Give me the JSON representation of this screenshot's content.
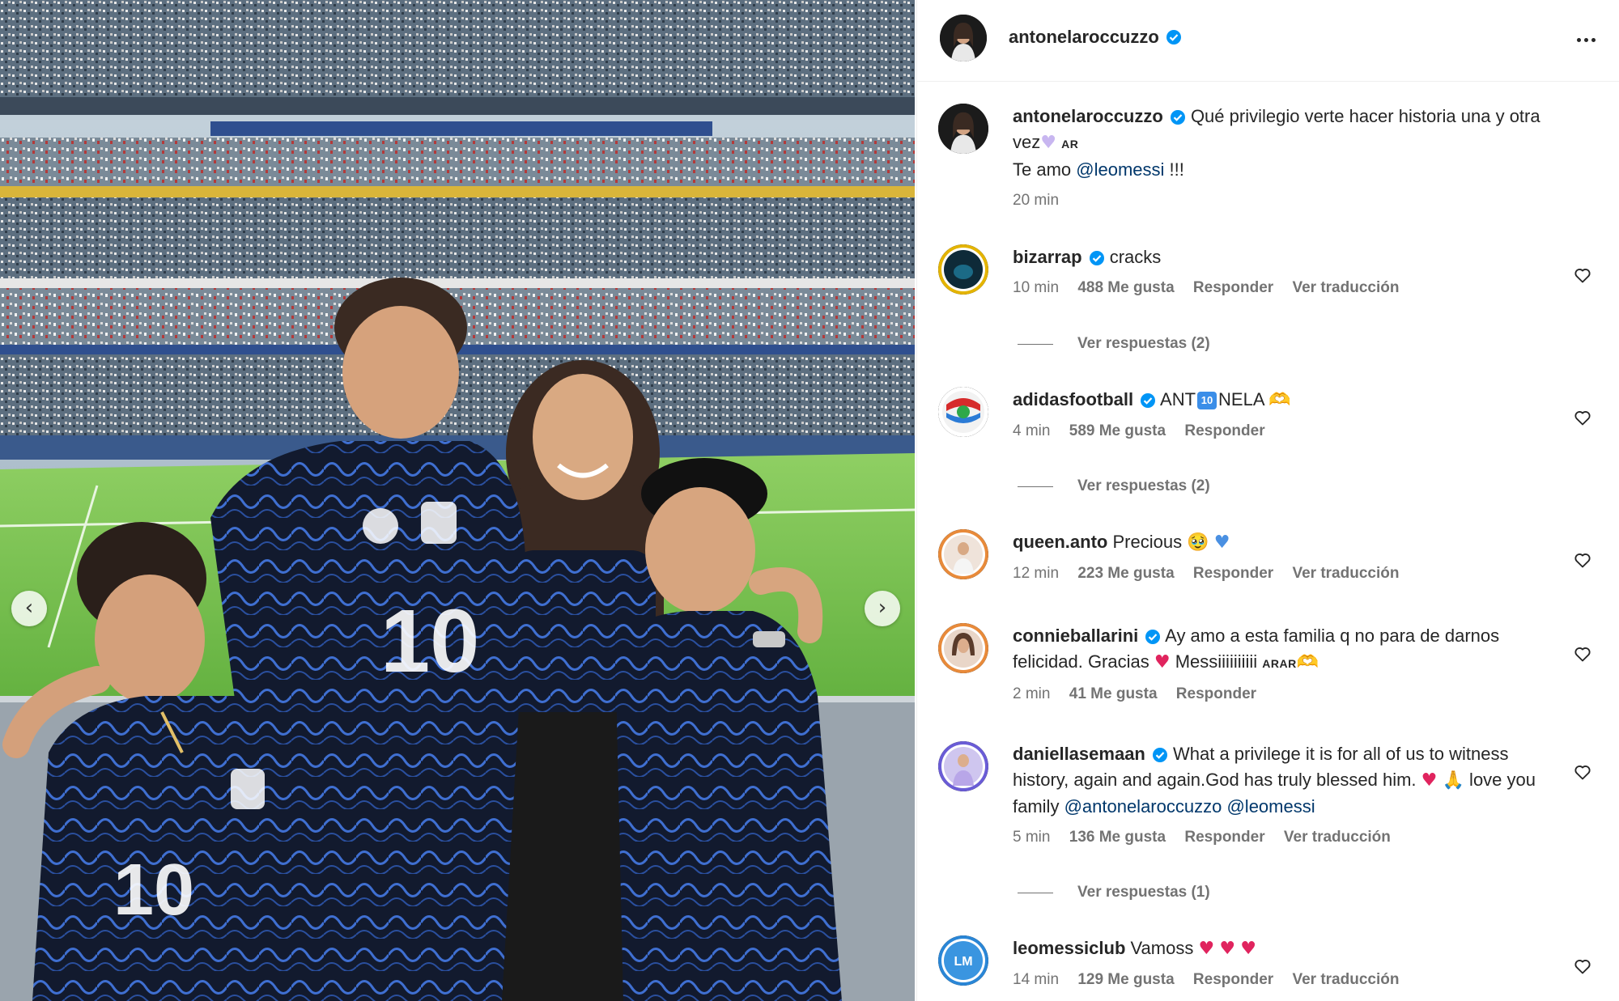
{
  "header": {
    "username": "antonelaroccuzzo",
    "more_icon": "more-horizontal-icon"
  },
  "colors": {
    "verified": "#0095f6",
    "meta_gray": "#737373",
    "mention": "#00376b",
    "heart_red": "#e0245e"
  },
  "caption": {
    "username": "antonelaroccuzzo",
    "text_part1": "Qué privilegio verte hacer historia una y otra vez",
    "flag": "AR",
    "text_part2": "Te amo ",
    "mention": "@leomessi",
    "text_part3": " !!!",
    "time": "20 min"
  },
  "comments": [
    {
      "username": "bizarrap",
      "text": "cracks",
      "time": "10 min",
      "likes": "488 Me gusta",
      "reply": "Responder",
      "translate": "Ver traducción",
      "view_replies": "Ver respuestas (2)"
    },
    {
      "username": "adidasfootball",
      "text_a": "ANT",
      "ten_badge": "10",
      "text_b": "NELA",
      "time": "4 min",
      "likes": "589 Me gusta",
      "reply": "Responder",
      "view_replies": "Ver respuestas (2)"
    },
    {
      "username": "queen.anto",
      "text": "Precious",
      "time": "12 min",
      "likes": "223 Me gusta",
      "reply": "Responder",
      "translate": "Ver traducción"
    },
    {
      "username": "connieballarini",
      "text_a": "Ay amo a esta familia q no para de darnos felicidad. Gracias",
      "text_b": " Messiiiiiiiiii",
      "flags": "ARAR",
      "time": "2 min",
      "likes": "41 Me gusta",
      "reply": "Responder"
    },
    {
      "username": "daniellasemaan",
      "text_a": "What a privilege it is for all of us to witness history, again and again.God has truly blessed him.",
      "text_b": " love you family ",
      "mention1": "@antonelaroccuzzo",
      "mention2": "@leomessi",
      "time": "5 min",
      "likes": "136 Me gusta",
      "reply": "Responder",
      "translate": "Ver traducción",
      "view_replies": "Ver respuestas (1)"
    },
    {
      "username": "leomessiclub",
      "text": "Vamoss",
      "time": "14 min",
      "likes": "129 Me gusta",
      "reply": "Responder",
      "translate": "Ver traducción"
    }
  ]
}
